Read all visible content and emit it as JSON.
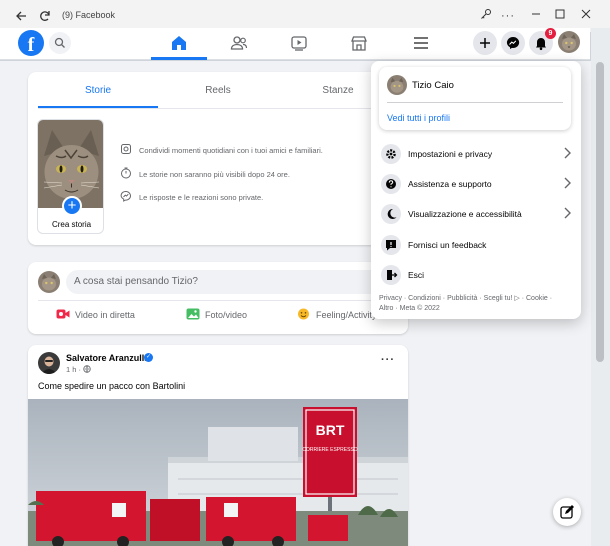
{
  "window": {
    "title": "(9) Facebook"
  },
  "navbar": {
    "logo_letter": "f",
    "notification_count": "9"
  },
  "stories": {
    "tabs": [
      {
        "label": "Storie",
        "active": true
      },
      {
        "label": "Reels",
        "active": false
      },
      {
        "label": "Stanze",
        "active": false
      }
    ],
    "create_label": "Crea storia",
    "create_plus": "+",
    "info": [
      {
        "icon": "stories-icon",
        "text": "Condividi momenti quotidiani con i tuoi amici e familiari."
      },
      {
        "icon": "timer-icon",
        "text": "Le storie non saranno più visibili dopo 24 ore."
      },
      {
        "icon": "messenger-icon",
        "text": "Le risposte e le reazioni sono private."
      }
    ]
  },
  "composer": {
    "placeholder": "A cosa stai pensando Tizio?",
    "actions": [
      {
        "label": "Video in diretta",
        "color": "#f02849"
      },
      {
        "label": "Foto/video",
        "color": "#45bd62"
      },
      {
        "label": "Feeling/Activity",
        "color": "#f7b928"
      }
    ]
  },
  "post": {
    "author": "Salvatore Aranzulla",
    "verified_mark": "✓",
    "time": "1 h ·",
    "more": "···",
    "text": "Come spedire un pacco con Bartolini",
    "sign_text": "BRT",
    "sign_subtext": "CORRIERE ESPRESSO"
  },
  "account_menu": {
    "profile_name": "Tizio Caio",
    "see_all_profiles": "Vedi tutti i profili",
    "items": [
      {
        "label": "Impostazioni e privacy",
        "icon": "gear-icon",
        "has_arrow": true
      },
      {
        "label": "Assistenza e supporto",
        "icon": "help-icon",
        "has_arrow": true
      },
      {
        "label": "Visualizzazione e accessibilità",
        "icon": "moon-icon",
        "has_arrow": true
      },
      {
        "label": "Fornisci un feedback",
        "icon": "feedback-icon",
        "has_arrow": false
      },
      {
        "label": "Esci",
        "icon": "logout-icon",
        "has_arrow": false
      }
    ],
    "footer_line1": "Privacy · Condizioni · Pubblicità · Scegli tu! ▷ · Cookie ·",
    "footer_line2": "Altro · Meta © 2022"
  },
  "colors": {
    "brand": "#1877f2",
    "badge": "#e41e3f"
  }
}
